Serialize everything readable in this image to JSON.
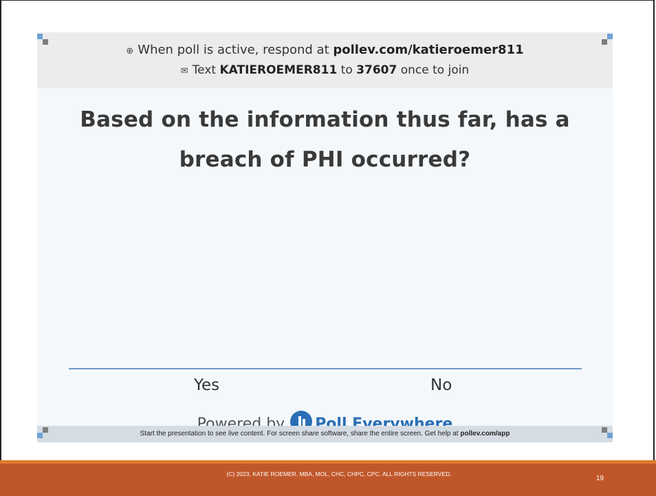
{
  "poll": {
    "header": {
      "line1_prefix": "When poll is active, respond at",
      "line1_url": "pollev.com/katieroemer811",
      "line2_prefix": "Text",
      "line2_code": "KATIEROEMER811",
      "line2_to": "to",
      "line2_number": "37607",
      "line2_suffix": "once to join"
    },
    "question": "Based on the information thus far, has a breach of PHI occurred?",
    "options": [
      "Yes",
      "No"
    ],
    "powered_by": "Powered by",
    "brand": "Poll Everywhere",
    "footer_text": "Start the presentation to see live content. For screen share software, share the entire screen. Get help at",
    "footer_link": "pollev.com/app",
    "icons": {
      "web": "globe-icon",
      "sms": "sms-icon",
      "logo": "poll-everywhere-logo-icon"
    }
  },
  "slide": {
    "copyright": "(C) 2023, KATIE ROEMER, MBA, MOL, CHC, CHPC, CPC. ALL RIGHTS RESERVED.",
    "page_number": "19"
  },
  "colors": {
    "bottom_bar": "#c0572a",
    "bottom_bar_accent": "#e07a2c",
    "axis_line": "#6f98c4",
    "brand_blue": "#2a6fb5"
  }
}
